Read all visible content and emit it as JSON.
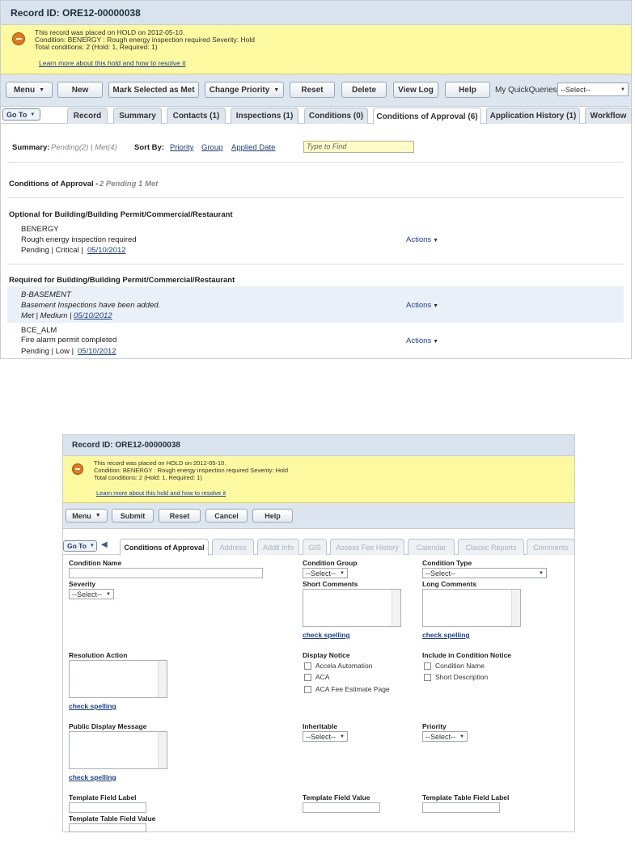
{
  "panel1": {
    "record_title": "Record ID: ORE12-00000038",
    "hold": {
      "line1": "This record was placed on HOLD on 2012-05-10.",
      "line2": "Condition: BENERGY : Rough energy inspection required Severity: Hold",
      "line3": "Total conditions: 2   (Hold: 1, Required: 1)",
      "link": "Learn more about this hold and how to resolve it"
    },
    "toolbar": {
      "menu": "Menu",
      "new": "New",
      "mark_met": "Mark Selected as Met",
      "change_priority": "Change Priority",
      "reset": "Reset",
      "delete": "Delete",
      "view_log": "View Log",
      "help": "Help",
      "quickqueries_label": "My QuickQueries",
      "quickqueries_value": "--Select--"
    },
    "goto": "Go To",
    "tabs": [
      "Record",
      "Summary",
      "Contacts (1)",
      "Inspections (1)",
      "Conditions (0)",
      "Conditions of Approval (6)",
      "Application History (1)",
      "Workflow"
    ],
    "summary": {
      "label": "Summary:",
      "counts": "Pending(2) | Met(4)",
      "sort_label": "Sort By:",
      "sort_priority": "Priority",
      "sort_group": "Group",
      "sort_date": "Applied Date",
      "find_placeholder": "Type to Find"
    },
    "coa": {
      "title": "Conditions of Approval -",
      "status": "2 Pending  1 Met"
    },
    "groups": [
      {
        "header": "Optional for Building/Building Permit/Commercial/Restaurant",
        "items": [
          {
            "code": "BENERGY",
            "desc": "Rough energy inspection required",
            "meta": "Pending | Critical |",
            "date": "05/10/2012",
            "action": "Actions"
          }
        ]
      },
      {
        "header": "Required for Building/Building Permit/Commercial/Restaurant",
        "items": [
          {
            "code": "B-BASEMENT",
            "desc": "Basement Inspections have been added.",
            "meta": "Met | Medium |",
            "date": "05/10/2012",
            "action": "Actions"
          },
          {
            "code": "BCE_ALM",
            "desc": "Fire alarm permit completed",
            "meta": "Pending | Low |",
            "date": "05/10/2012",
            "action": "Actions"
          }
        ]
      }
    ]
  },
  "panel2": {
    "record_title": "Record ID: ORE12-00000038",
    "hold": {
      "line1": "This record was placed on HOLD on 2012-05-10.",
      "line2": "Condition: BENERGY : Rough energy inspection required Severity: Hold",
      "line3": "Total conditions: 2   (Hold: 1, Required: 1)",
      "link": "Learn more about this hold and how to resolve it"
    },
    "toolbar": {
      "menu": "Menu",
      "submit": "Submit",
      "reset": "Reset",
      "cancel": "Cancel",
      "help": "Help"
    },
    "goto": "Go To",
    "tabs": [
      "Conditions of Approval",
      "Address",
      "Addtl Info",
      "GIS",
      "Assess Fee History",
      "Calendar",
      "Classic Reports",
      "Comments"
    ],
    "form": {
      "condition_name": "Condition Name",
      "condition_group": "Condition Group",
      "condition_type": "Condition Type",
      "severity": "Severity",
      "short_comments": "Short Comments",
      "long_comments": "Long Comments",
      "resolution_action": "Resolution Action",
      "display_notice": "Display Notice",
      "include_notice": "Include in Condition Notice",
      "public_display": "Public Display Message",
      "inheritable": "Inheritable",
      "priority": "Priority",
      "template_field_label": "Template Field Label",
      "template_field_value": "Template Field Value",
      "template_table_field_label": "Template Table Field Label",
      "template_table_field_value": "Template Table Field Value",
      "select": "--Select--",
      "check_spelling": "check spelling",
      "display_options": [
        "Accela Automation",
        "ACA",
        "ACA Fee Estimate Page"
      ],
      "include_options": [
        "Condition Name",
        "Short Description"
      ]
    }
  }
}
